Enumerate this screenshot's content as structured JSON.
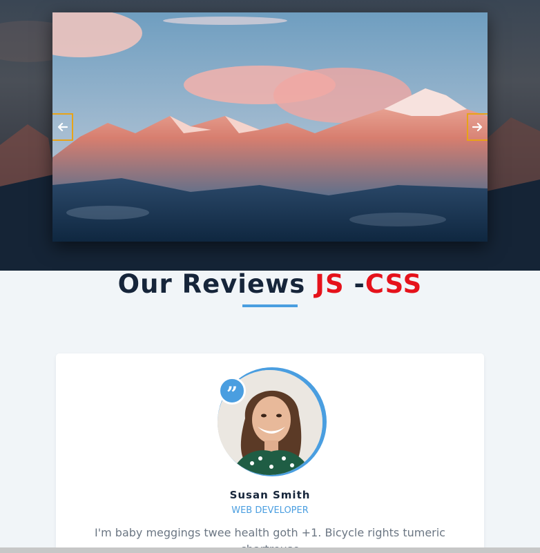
{
  "hero": {
    "prev_icon": "arrow-left-icon",
    "next_icon": "arrow-right-icon",
    "accent_color": "#e8a317"
  },
  "section": {
    "title_main": "Our Reviews ",
    "title_js": "JS",
    "title_sep": " -",
    "title_css": "CSS",
    "title_color": "#16253a",
    "highlight_color": "#e5121b",
    "underline_color": "#4a9ee0"
  },
  "review": {
    "quote_icon": "quote-icon",
    "quote_glyph": "”",
    "name": "Susan Smith",
    "role": "WEB DEVELOPER",
    "text": "I'm baby meggings twee health goth +1. Bicycle rights tumeric chartreuse"
  }
}
